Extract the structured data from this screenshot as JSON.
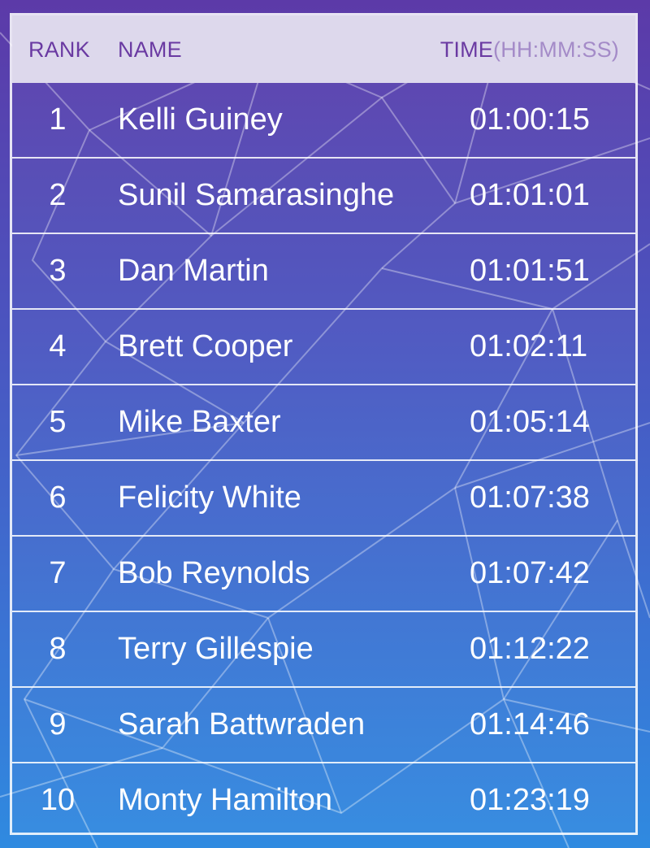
{
  "colors": {
    "background_top": "#5c3aa8",
    "background_bottom": "#2f8ae0",
    "header_bg": "#ddd8ec",
    "header_text": "#6a3aa2",
    "header_unit_text": "#a48bc8",
    "row_text": "#ffffff",
    "divider": "#ffffff"
  },
  "header": {
    "rank": "RANK",
    "name": "NAME",
    "time": "TIME",
    "time_unit": "(HH:MM:SS)"
  },
  "rows": [
    {
      "rank": "1",
      "name": "Kelli Guiney",
      "time": "01:00:15"
    },
    {
      "rank": "2",
      "name": "Sunil Samarasinghe",
      "time": "01:01:01"
    },
    {
      "rank": "3",
      "name": "Dan Martin",
      "time": "01:01:51"
    },
    {
      "rank": "4",
      "name": "Brett Cooper",
      "time": "01:02:11"
    },
    {
      "rank": "5",
      "name": "Mike Baxter",
      "time": "01:05:14"
    },
    {
      "rank": "6",
      "name": "Felicity White",
      "time": "01:07:38"
    },
    {
      "rank": "7",
      "name": "Bob Reynolds",
      "time": "01:07:42"
    },
    {
      "rank": "8",
      "name": "Terry Gillespie",
      "time": "01:12:22"
    },
    {
      "rank": "9",
      "name": "Sarah Battwraden",
      "time": "01:14:46"
    },
    {
      "rank": "10",
      "name": "Monty Hamilton",
      "time": "01:23:19"
    }
  ]
}
